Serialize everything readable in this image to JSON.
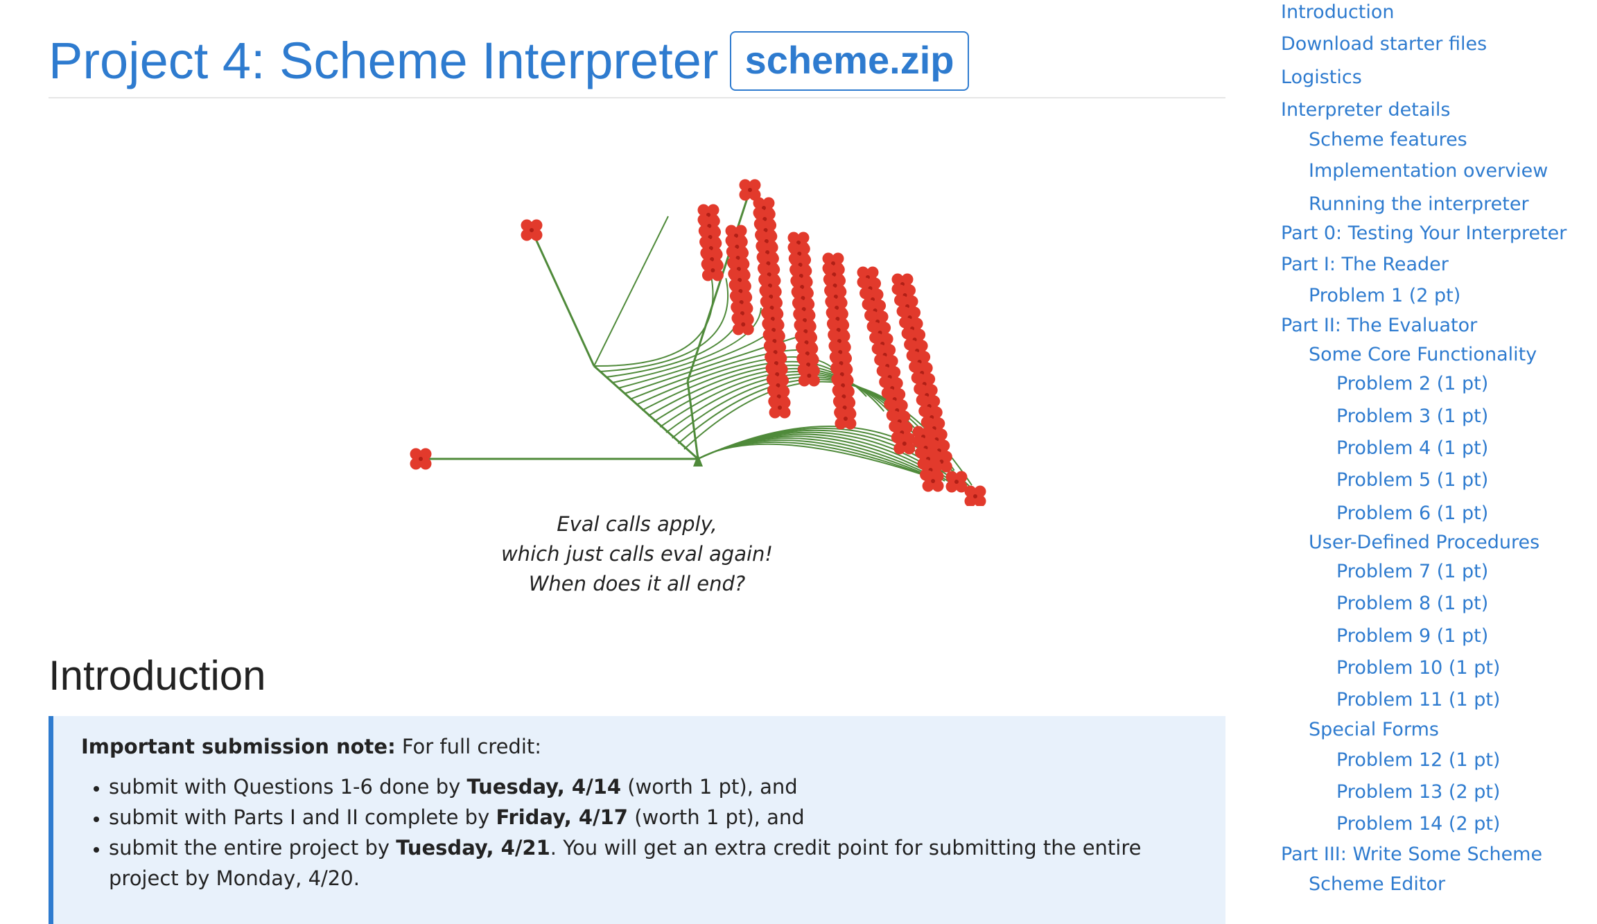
{
  "header": {
    "title": "Project 4: Scheme Interpreter",
    "zip_label": "scheme.zip"
  },
  "figure": {
    "caption_lines": [
      "Eval calls apply,",
      "which just calls eval again!",
      "When does it all end?"
    ],
    "colors": {
      "stem": "#4f8a3a",
      "flower": "#e23a2c"
    }
  },
  "intro": {
    "heading": "Introduction",
    "note": {
      "lead_bold": "Important submission note:",
      "lead_rest": " For full credit:",
      "items": [
        {
          "pre": "submit with Questions 1-6 done by ",
          "bold": "Tuesday, 4/14",
          "post": " (worth 1 pt), and"
        },
        {
          "pre": "submit with Parts I and II complete by ",
          "bold": "Friday, 4/17",
          "post": " (worth 1 pt), and"
        },
        {
          "pre": "submit the entire project by ",
          "bold": "Tuesday, 4/21",
          "post": ". You will get an extra credit point for submitting the entire project by Monday, 4/20."
        }
      ]
    }
  },
  "toc": {
    "items": [
      {
        "label": "Introduction",
        "level": 0
      },
      {
        "label": "Download starter files",
        "level": 0
      },
      {
        "label": "Logistics",
        "level": 0
      },
      {
        "label": "Interpreter details",
        "level": 0
      },
      {
        "label": "Scheme features",
        "level": 1
      },
      {
        "label": "Implementation overview",
        "level": 1
      },
      {
        "label": "Running the interpreter",
        "level": 1
      },
      {
        "label": "Part 0: Testing Your Interpreter",
        "level": 0
      },
      {
        "label": "Part I: The Reader",
        "level": 0
      },
      {
        "label": "Problem 1 (2 pt)",
        "level": 1
      },
      {
        "label": "Part II: The Evaluator",
        "level": 0
      },
      {
        "label": "Some Core Functionality",
        "level": 1
      },
      {
        "label": "Problem 2 (1 pt)",
        "level": 2
      },
      {
        "label": "Problem 3 (1 pt)",
        "level": 2
      },
      {
        "label": "Problem 4 (1 pt)",
        "level": 2
      },
      {
        "label": "Problem 5 (1 pt)",
        "level": 2
      },
      {
        "label": "Problem 6 (1 pt)",
        "level": 2
      },
      {
        "label": "User-Defined Procedures",
        "level": 1
      },
      {
        "label": "Problem 7 (1 pt)",
        "level": 2
      },
      {
        "label": "Problem 8 (1 pt)",
        "level": 2
      },
      {
        "label": "Problem 9 (1 pt)",
        "level": 2
      },
      {
        "label": "Problem 10 (1 pt)",
        "level": 2
      },
      {
        "label": "Problem 11 (1 pt)",
        "level": 2
      },
      {
        "label": "Special Forms",
        "level": 1
      },
      {
        "label": "Problem 12 (1 pt)",
        "level": 2
      },
      {
        "label": "Problem 13 (2 pt)",
        "level": 2
      },
      {
        "label": "Problem 14 (2 pt)",
        "level": 2
      },
      {
        "label": "Part III: Write Some Scheme",
        "level": 0
      },
      {
        "label": "Scheme Editor",
        "level": 1
      }
    ]
  }
}
